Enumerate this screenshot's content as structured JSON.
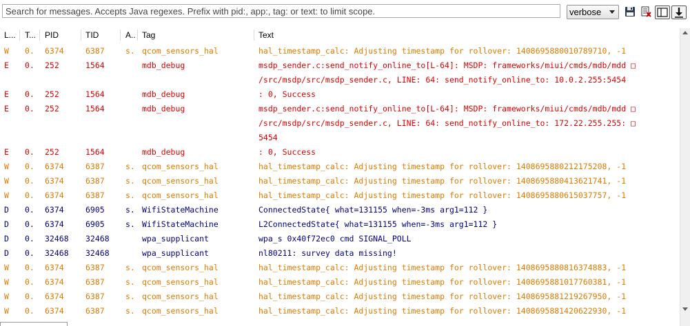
{
  "toolbar": {
    "search_placeholder": "Search for messages. Accepts Java regexes. Prefix with pid:, app:, tag: or text: to limit scope.",
    "log_level": "verbose",
    "buttons": [
      "save-icon",
      "clear-log-icon",
      "toggle-columns-icon",
      "scroll-lock-icon"
    ]
  },
  "columns": [
    "L...",
    "T...",
    "PID",
    "TID",
    "A...",
    "Tag",
    "Text"
  ],
  "colors": {
    "W": "#e07b00",
    "E": "#e00000",
    "D": "#000080"
  },
  "rows": [
    {
      "level": "W",
      "time": "0.",
      "pid": "6374",
      "tid": "6387",
      "app": "s.",
      "tag": "qcom_sensors_hal",
      "text": [
        "hal_timestamp_calc: Adjusting timestamp for rollover: 1408695880010789710, -1"
      ]
    },
    {
      "level": "E",
      "time": "0.",
      "pid": "252",
      "tid": "1564",
      "app": "",
      "tag": "mdb_debug",
      "text": [
        "msdp_sender.c:send_notify_online_to[L-64]: MSDP: frameworks/miui/cmds/mdb/mdd □",
        "/src/msdp/src/msdp_sender.c, LINE: 64: send_notify_online_to: 10.0.2.255:5454"
      ]
    },
    {
      "level": "E",
      "time": "0.",
      "pid": "252",
      "tid": "1564",
      "app": "",
      "tag": "mdb_debug",
      "text": [
        ": 0, Success"
      ]
    },
    {
      "level": "E",
      "time": "0.",
      "pid": "252",
      "tid": "1564",
      "app": "",
      "tag": "mdb_debug",
      "text": [
        "msdp_sender.c:send_notify_online_to[L-64]: MSDP: frameworks/miui/cmds/mdb/mdd □",
        "/src/msdp/src/msdp_sender.c, LINE: 64: send_notify_online_to: 172.22.255.255: □",
        "5454"
      ]
    },
    {
      "level": "E",
      "time": "0.",
      "pid": "252",
      "tid": "1564",
      "app": "",
      "tag": "mdb_debug",
      "text": [
        ": 0, Success"
      ]
    },
    {
      "level": "W",
      "time": "0.",
      "pid": "6374",
      "tid": "6387",
      "app": "s.",
      "tag": "qcom_sensors_hal",
      "text": [
        "hal_timestamp_calc: Adjusting timestamp for rollover: 1408695880212175208, -1"
      ]
    },
    {
      "level": "W",
      "time": "0.",
      "pid": "6374",
      "tid": "6387",
      "app": "s.",
      "tag": "qcom_sensors_hal",
      "text": [
        "hal_timestamp_calc: Adjusting timestamp for rollover: 1408695880413621741, -1"
      ]
    },
    {
      "level": "W",
      "time": "0.",
      "pid": "6374",
      "tid": "6387",
      "app": "s.",
      "tag": "qcom_sensors_hal",
      "text": [
        "hal_timestamp_calc: Adjusting timestamp for rollover: 1408695880615037757, -1"
      ]
    },
    {
      "level": "D",
      "time": "0.",
      "pid": "6374",
      "tid": "6905",
      "app": "s.",
      "tag": "WifiStateMachine",
      "text": [
        "ConnectedState{ what=131155 when=-3ms arg1=112 }"
      ]
    },
    {
      "level": "D",
      "time": "0.",
      "pid": "6374",
      "tid": "6905",
      "app": "s.",
      "tag": "WifiStateMachine",
      "text": [
        "L2ConnectedState{ what=131155 when=-3ms arg1=112 }"
      ]
    },
    {
      "level": "D",
      "time": "0.",
      "pid": "32468",
      "tid": "32468",
      "app": "",
      "tag": "wpa_supplicant",
      "text": [
        "wpa_s 0x40f72ec0 cmd SIGNAL_POLL"
      ]
    },
    {
      "level": "D",
      "time": "0.",
      "pid": "32468",
      "tid": "32468",
      "app": "",
      "tag": "wpa_supplicant",
      "text": [
        "nl80211: survey data missing!"
      ]
    },
    {
      "level": "W",
      "time": "0.",
      "pid": "6374",
      "tid": "6387",
      "app": "s.",
      "tag": "qcom_sensors_hal",
      "text": [
        "hal_timestamp_calc: Adjusting timestamp for rollover: 1408695880816374883, -1"
      ]
    },
    {
      "level": "W",
      "time": "0.",
      "pid": "6374",
      "tid": "6387",
      "app": "s.",
      "tag": "qcom_sensors_hal",
      "text": [
        "hal_timestamp_calc: Adjusting timestamp for rollover: 1408695881017760381, -1"
      ]
    },
    {
      "level": "W",
      "time": "0.",
      "pid": "6374",
      "tid": "6387",
      "app": "s.",
      "tag": "qcom_sensors_hal",
      "text": [
        "hal_timestamp_calc: Adjusting timestamp for rollover: 1408695881219267950, -1"
      ]
    },
    {
      "level": "W",
      "time": "0.",
      "pid": "6374",
      "tid": "6387",
      "app": "s.",
      "tag": "qcom_sensors_hal",
      "text": [
        "hal_timestamp_calc: Adjusting timestamp for rollover: 1408695881420622930, -1"
      ]
    }
  ]
}
